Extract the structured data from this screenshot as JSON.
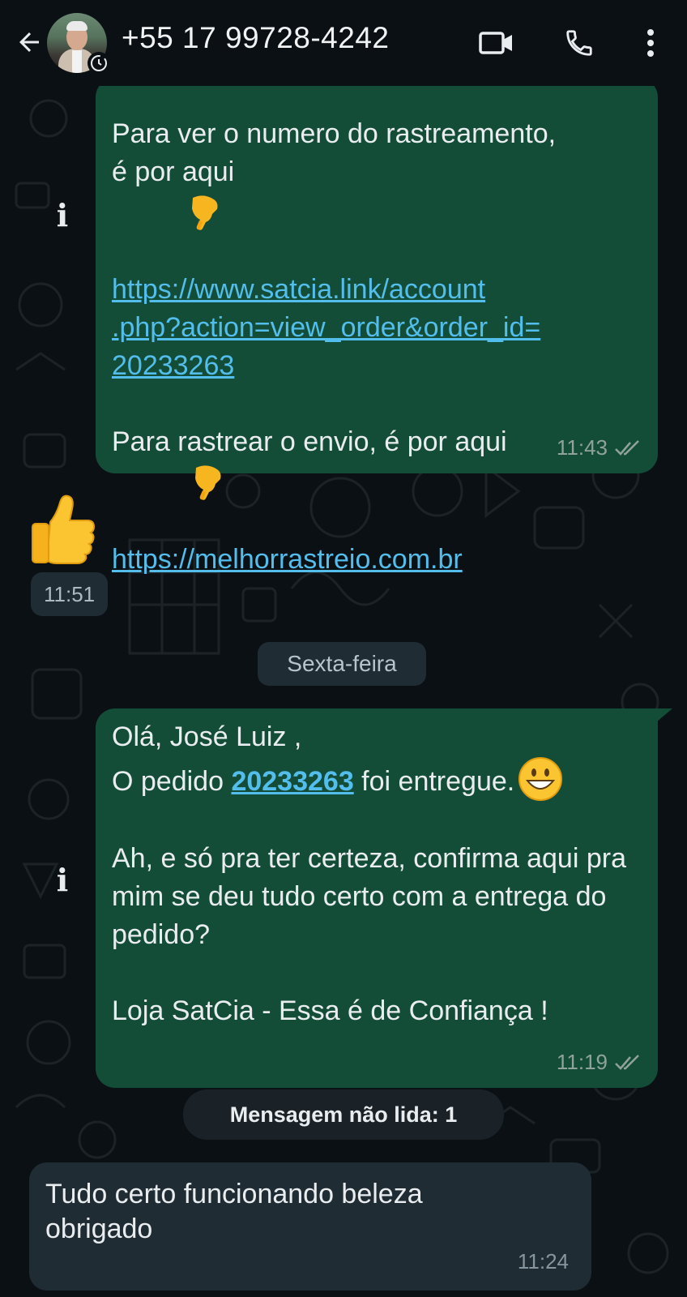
{
  "header": {
    "back_icon": "arrow-left-icon",
    "contact_name": "+55 17 99728-4242",
    "video_icon": "video-camera-icon",
    "call_icon": "phone-icon",
    "menu_icon": "more-vertical-icon"
  },
  "messages": {
    "first": {
      "line1": "Para ver o numero do rastreamento,",
      "line2": "é por aqui",
      "link1_a": "https://www.satcia.link/account",
      "link1_b": ".php?action=view_order&order_id=",
      "link1_c": "20233263",
      "line3": "Para rastrear o envio, é por aqui",
      "link2": "https://melhorrastreio.com.br",
      "time": "11:43"
    },
    "thumb": {
      "emoji": "👍",
      "time": "11:51"
    },
    "date_divider": "Sexta-feira",
    "second": {
      "greeting": "Olá, José Luiz ,",
      "order_prefix": "O pedido ",
      "order_number": "20233263",
      "order_suffix": " foi entregue.",
      "para1": "Ah, e só pra ter certeza, confirma aqui pra mim se deu tudo certo com a entrega do pedido?",
      "signature": "Loja SatCia - Essa é de Confiança !",
      "time": "11:19"
    },
    "unread_divider": "Mensagem não lida: 1",
    "reply": {
      "text": "Tudo certo funcionando beleza obrigado",
      "time": "11:24"
    }
  },
  "colors": {
    "background": "#0b1014",
    "outgoing_bubble": "#144d37",
    "incoming_bubble": "#202c33",
    "link": "#53bdeb"
  }
}
